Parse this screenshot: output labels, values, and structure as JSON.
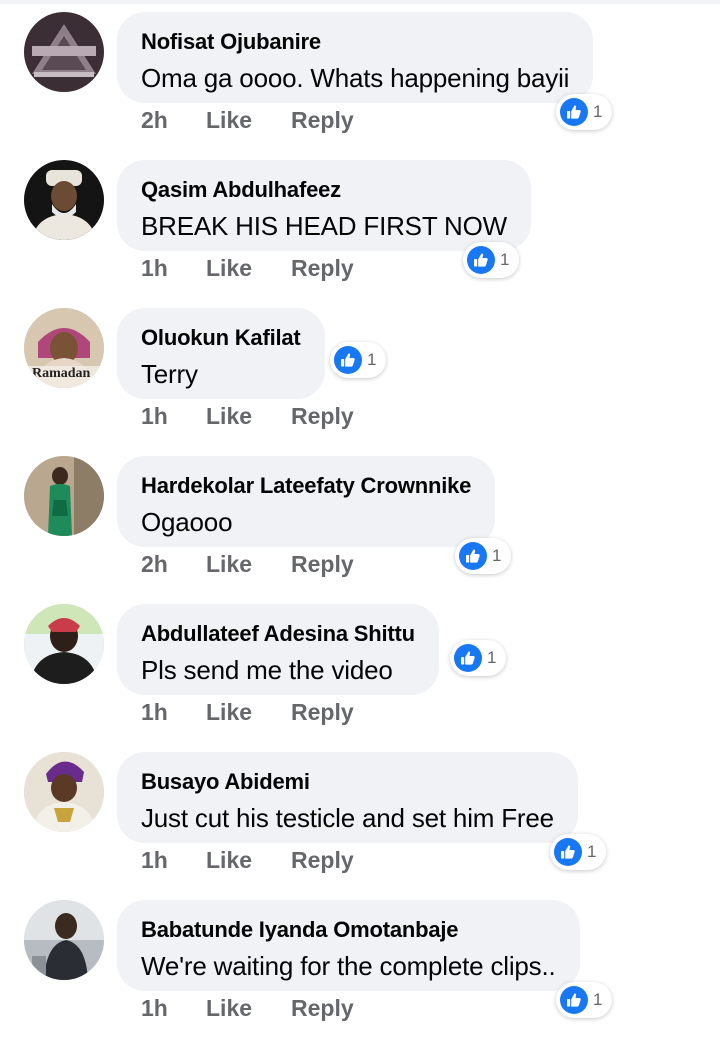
{
  "comments": [
    {
      "author": "Nofisat Ojubanire",
      "text": "Oma ga oooo. Whats happening bayii",
      "time": "2h",
      "like": "Like",
      "reply": "Reply",
      "reactions": "1"
    },
    {
      "author": "Qasim Abdulhafeez",
      "text": "BREAK HIS HEAD FIRST NOW",
      "time": "1h",
      "like": "Like",
      "reply": "Reply",
      "reactions": "1"
    },
    {
      "author": "Oluokun Kafilat",
      "text": "Terry",
      "time": "1h",
      "like": "Like",
      "reply": "Reply",
      "reactions": "1",
      "avatar_caption": "Ramadan"
    },
    {
      "author": "Hardekolar Lateefaty Crownnike",
      "text": "Ogaooo",
      "time": "2h",
      "like": "Like",
      "reply": "Reply",
      "reactions": "1"
    },
    {
      "author": "Abdullateef Adesina Shittu",
      "text": "Pls send me the video",
      "time": "1h",
      "like": "Like",
      "reply": "Reply",
      "reactions": "1"
    },
    {
      "author": "Busayo Abidemi",
      "text": "Just cut his testicle and set him Free",
      "time": "1h",
      "like": "Like",
      "reply": "Reply",
      "reactions": "1"
    },
    {
      "author": "Babatunde Iyanda Omotanbaje",
      "text": "We're waiting for the complete  clips..",
      "time": "1h",
      "like": "Like",
      "reply": "Reply",
      "reactions": "1"
    }
  ],
  "icons": {
    "reaction": "like-thumb-icon"
  },
  "colors": {
    "bubble": "#f0f2f5",
    "like_blue": "#1877f2",
    "meta_gray": "#65676b"
  }
}
